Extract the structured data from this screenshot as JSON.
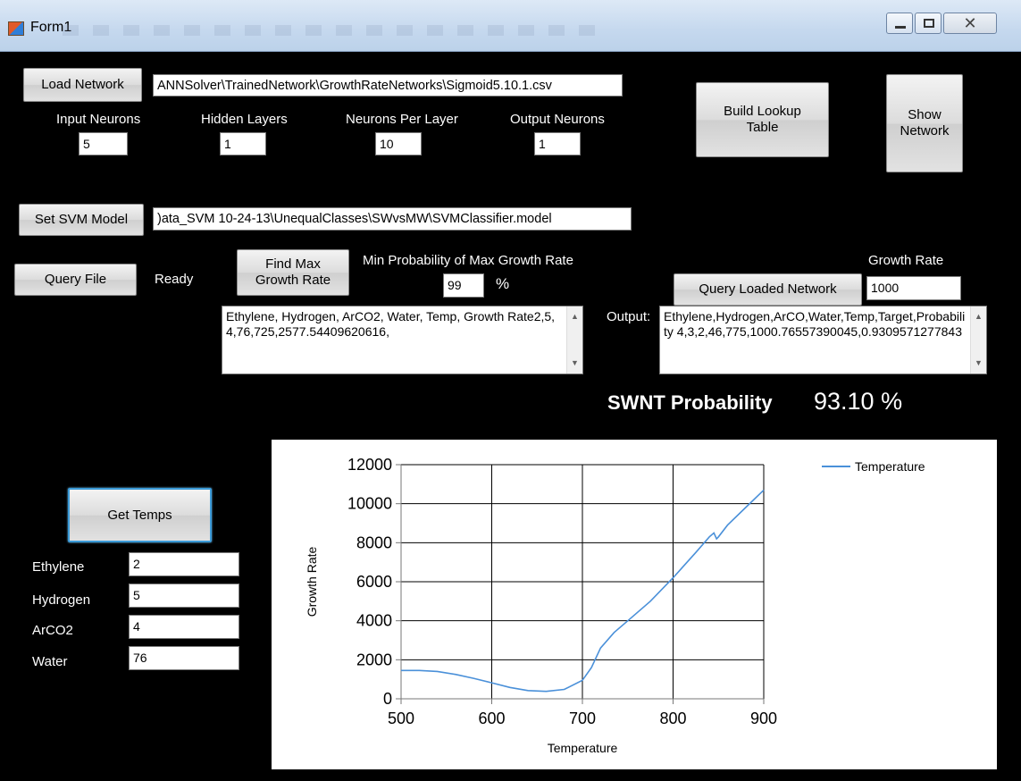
{
  "window": {
    "title": "Form1"
  },
  "network": {
    "load_label": "Load Network",
    "path": "ANNSolver\\TrainedNetwork\\GrowthRateNetworks\\Sigmoid5.10.1.csv",
    "input_neurons_label": "Input Neurons",
    "input_neurons": "5",
    "hidden_layers_label": "Hidden Layers",
    "hidden_layers": "1",
    "neurons_per_layer_label": "Neurons Per Layer",
    "neurons_per_layer": "10",
    "output_neurons_label": "Output Neurons",
    "output_neurons": "1",
    "build_lookup_label": "Build Lookup Table",
    "show_network_label": "Show Network"
  },
  "svm": {
    "set_label": "Set SVM Model",
    "path": ")ata_SVM 10-24-13\\UnequalClasses\\SWvsMW\\SVMClassifier.model"
  },
  "query": {
    "query_file_label": "Query File",
    "status": "Ready",
    "find_max_label": "Find Max Growth Rate",
    "min_prob_label": "Min Probability of Max Growth Rate",
    "min_prob_value": "99",
    "percent_sign": "%",
    "query_loaded_label": "Query Loaded Network",
    "growth_rate_label": "Growth Rate",
    "growth_rate_value": "1000",
    "input_text": "Ethylene, Hydrogen, ArCO2, Water, Temp, Growth Rate2,5,4,76,725,2577.54409620616,",
    "output_label": "Output:",
    "output_text": "Ethylene,Hydrogen,ArCO,Water,Temp,Target,Probability 4,3,2,46,775,1000.76557390045,0.9309571277843",
    "swnt_label": "SWNT Probability",
    "swnt_value": "93.10 %"
  },
  "temps": {
    "get_temps_label": "Get Temps",
    "ethylene_label": "Ethylene",
    "ethylene_value": "2",
    "hydrogen_label": "Hydrogen",
    "hydrogen_value": "5",
    "arco2_label": "ArCO2",
    "arco2_value": "4",
    "water_label": "Water",
    "water_value": "76"
  },
  "chart_data": {
    "type": "line",
    "title": "",
    "xlabel": "Temperature",
    "ylabel": "Growth Rate",
    "xlim": [
      500,
      900
    ],
    "ylim": [
      0,
      12000
    ],
    "x_ticks": [
      500,
      600,
      700,
      800,
      900
    ],
    "y_ticks": [
      0,
      2000,
      4000,
      6000,
      8000,
      10000,
      12000
    ],
    "grid": true,
    "legend_position": "top-right",
    "series": [
      {
        "name": "Temperature",
        "color": "#4a90d9",
        "x": [
          500,
          520,
          540,
          560,
          580,
          600,
          620,
          640,
          660,
          680,
          700,
          710,
          720,
          735,
          750,
          775,
          800,
          825,
          840,
          845,
          848,
          850,
          860,
          880,
          900
        ],
        "y": [
          1450,
          1450,
          1400,
          1250,
          1050,
          820,
          580,
          420,
          380,
          480,
          950,
          1600,
          2600,
          3400,
          4000,
          5000,
          6200,
          7500,
          8300,
          8500,
          8200,
          8300,
          8900,
          9800,
          10700
        ]
      }
    ]
  }
}
